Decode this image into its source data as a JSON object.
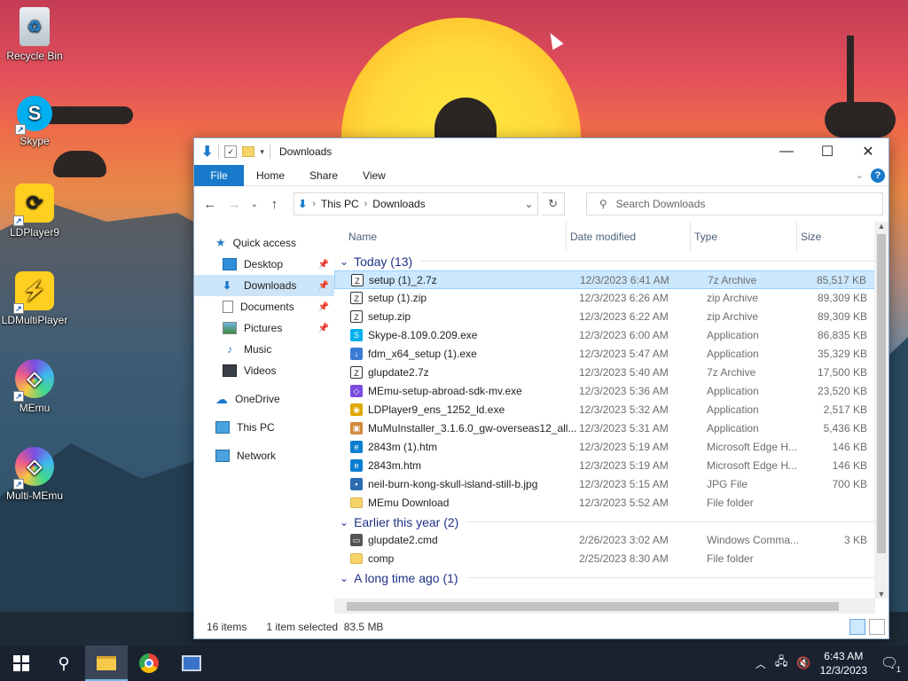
{
  "desktop": {
    "icons": [
      {
        "label": "Recycle Bin",
        "icon": "recycle-bin-icon"
      },
      {
        "label": "Skype",
        "icon": "skype-icon"
      },
      {
        "label": "LDPlayer9",
        "icon": "ldplayer-icon"
      },
      {
        "label": "LDMultiPlayer",
        "icon": "ldmultiplayer-icon"
      },
      {
        "label": "MEmu",
        "icon": "memu-icon"
      },
      {
        "label": "Multi-MEmu",
        "icon": "multi-memu-icon"
      }
    ]
  },
  "window": {
    "title": "Downloads",
    "ribbon": {
      "file": "File",
      "home": "Home",
      "share": "Share",
      "view": "View"
    },
    "address": {
      "root": "This PC",
      "current": "Downloads"
    },
    "search": {
      "placeholder": "Search Downloads"
    },
    "nav": {
      "quick_access": "Quick access",
      "items": [
        {
          "label": "Desktop",
          "pinned": true
        },
        {
          "label": "Downloads",
          "pinned": true
        },
        {
          "label": "Documents",
          "pinned": true
        },
        {
          "label": "Pictures",
          "pinned": true
        },
        {
          "label": "Music"
        },
        {
          "label": "Videos"
        }
      ],
      "onedrive": "OneDrive",
      "this_pc": "This PC",
      "network": "Network"
    },
    "columns": {
      "name": "Name",
      "date": "Date modified",
      "type": "Type",
      "size": "Size"
    },
    "groups": [
      {
        "title": "Today (13)",
        "files": [
          {
            "name": "setup (1)_2.7z",
            "date": "12/3/2023 6:41 AM",
            "type": "7z Archive",
            "size": "85,517 KB",
            "selected": true,
            "icon": "7z"
          },
          {
            "name": "setup (1).zip",
            "date": "12/3/2023 6:26 AM",
            "type": "zip Archive",
            "size": "89,309 KB",
            "icon": "zip"
          },
          {
            "name": "setup.zip",
            "date": "12/3/2023 6:22 AM",
            "type": "zip Archive",
            "size": "89,309 KB",
            "icon": "zip"
          },
          {
            "name": "Skype-8.109.0.209.exe",
            "date": "12/3/2023 6:00 AM",
            "type": "Application",
            "size": "86,835 KB",
            "icon": "skype"
          },
          {
            "name": "fdm_x64_setup (1).exe",
            "date": "12/3/2023 5:47 AM",
            "type": "Application",
            "size": "35,329 KB",
            "icon": "fdm"
          },
          {
            "name": "glupdate2.7z",
            "date": "12/3/2023 5:40 AM",
            "type": "7z Archive",
            "size": "17,500 KB",
            "icon": "7z"
          },
          {
            "name": "MEmu-setup-abroad-sdk-mv.exe",
            "date": "12/3/2023 5:36 AM",
            "type": "Application",
            "size": "23,520 KB",
            "icon": "memu"
          },
          {
            "name": "LDPlayer9_ens_1252_ld.exe",
            "date": "12/3/2023 5:32 AM",
            "type": "Application",
            "size": "2,517 KB",
            "icon": "ld"
          },
          {
            "name": "MuMuInstaller_3.1.6.0_gw-overseas12_all...",
            "date": "12/3/2023 5:31 AM",
            "type": "Application",
            "size": "5,436 KB",
            "icon": "mumu"
          },
          {
            "name": "2843m (1).htm",
            "date": "12/3/2023 5:19 AM",
            "type": "Microsoft Edge H...",
            "size": "146 KB",
            "icon": "edge"
          },
          {
            "name": "2843m.htm",
            "date": "12/3/2023 5:19 AM",
            "type": "Microsoft Edge H...",
            "size": "146 KB",
            "icon": "edge"
          },
          {
            "name": "neil-burn-kong-skull-island-still-b.jpg",
            "date": "12/3/2023 5:15 AM",
            "type": "JPG File",
            "size": "700 KB",
            "icon": "jpg"
          },
          {
            "name": "MEmu Download",
            "date": "12/3/2023 5:52 AM",
            "type": "File folder",
            "size": "",
            "icon": "folder"
          }
        ]
      },
      {
        "title": "Earlier this year (2)",
        "files": [
          {
            "name": "glupdate2.cmd",
            "date": "2/26/2023 3:02 AM",
            "type": "Windows Comma...",
            "size": "3 KB",
            "icon": "cmd"
          },
          {
            "name": "comp",
            "date": "2/25/2023 8:30 AM",
            "type": "File folder",
            "size": "",
            "icon": "folder"
          }
        ]
      },
      {
        "title": "A long time ago (1)",
        "files": []
      }
    ],
    "status": {
      "count": "16 items",
      "selected": "1 item selected",
      "size": "83.5 MB"
    }
  },
  "taskbar": {
    "time": "6:43 AM",
    "date": "12/3/2023",
    "notifications": "1"
  },
  "colors": {
    "accent": "#1979ca",
    "selection": "#cce8ff",
    "taskbar": "#1a2230"
  }
}
